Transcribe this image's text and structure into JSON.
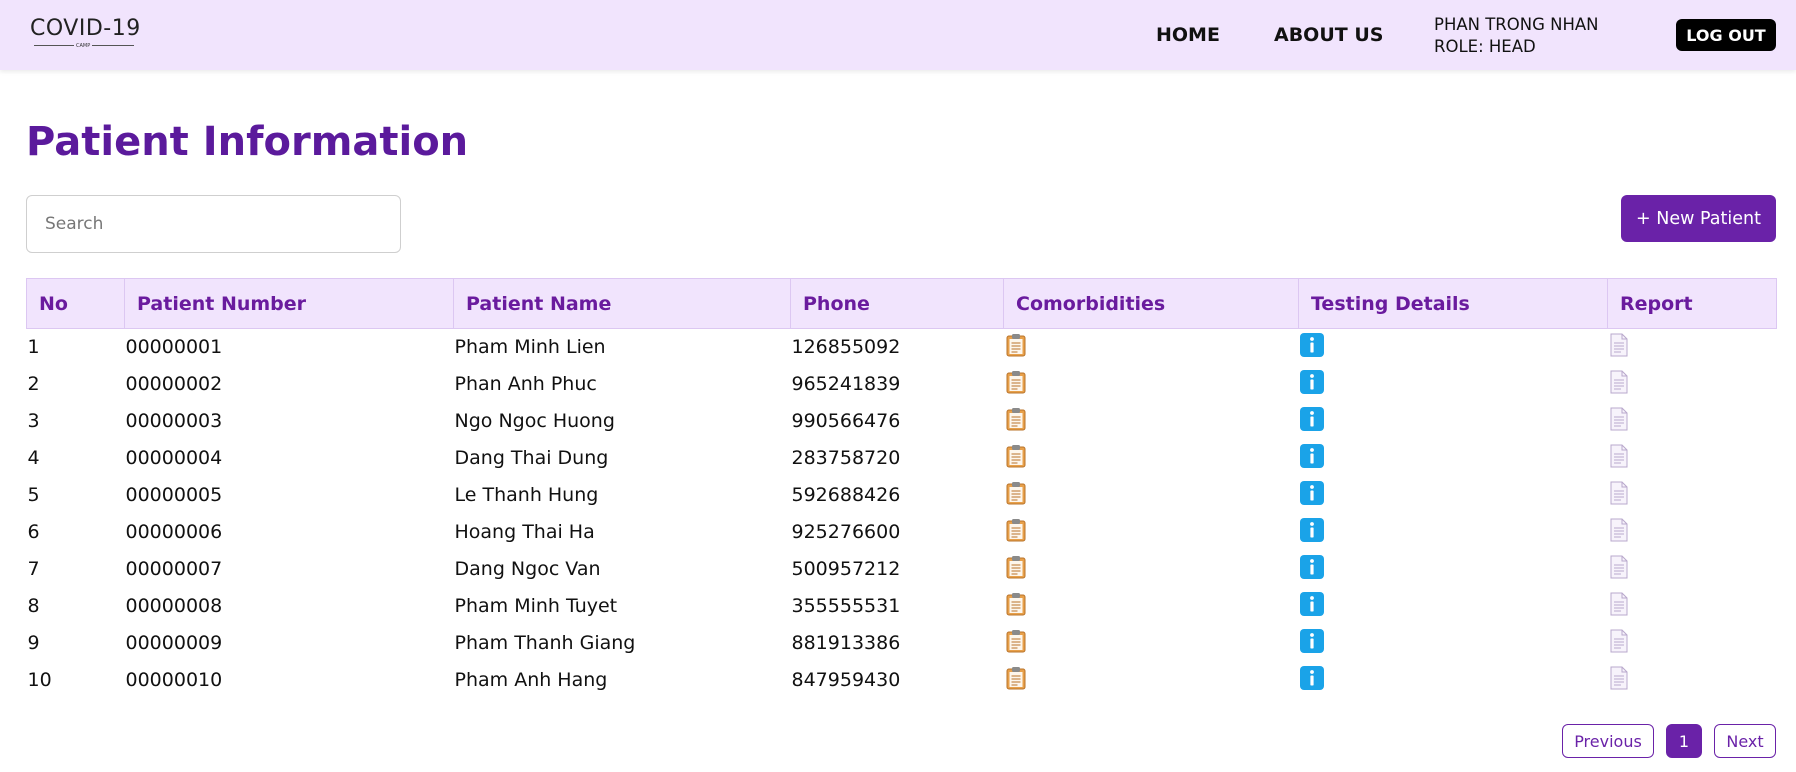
{
  "header": {
    "logo_text": "COVID-19",
    "logo_sub": "CAMP",
    "nav": {
      "home": "HOME",
      "about": "ABOUT US"
    },
    "user": {
      "name": "PHAN TRONG NHAN",
      "role": "ROLE: HEAD"
    },
    "logout_label": "LOG OUT"
  },
  "page": {
    "title": "Patient Information",
    "search_placeholder": "Search",
    "new_patient_label": "+ New Patient"
  },
  "table": {
    "columns": [
      "No",
      "Patient Number",
      "Patient Name",
      "Phone",
      "Comorbidities",
      "Testing Details",
      "Report"
    ],
    "rows": [
      {
        "no": "1",
        "number": "00000001",
        "name": "Pham Minh Lien",
        "phone": "126855092"
      },
      {
        "no": "2",
        "number": "00000002",
        "name": "Phan Anh Phuc",
        "phone": "965241839"
      },
      {
        "no": "3",
        "number": "00000003",
        "name": "Ngo Ngoc Huong",
        "phone": "990566476"
      },
      {
        "no": "4",
        "number": "00000004",
        "name": "Dang Thai Dung",
        "phone": "283758720"
      },
      {
        "no": "5",
        "number": "00000005",
        "name": "Le Thanh Hung",
        "phone": "592688426"
      },
      {
        "no": "6",
        "number": "00000006",
        "name": "Hoang Thai Ha",
        "phone": "925276600"
      },
      {
        "no": "7",
        "number": "00000007",
        "name": "Dang Ngoc Van",
        "phone": "500957212"
      },
      {
        "no": "8",
        "number": "00000008",
        "name": "Pham Minh Tuyet",
        "phone": "355555531"
      },
      {
        "no": "9",
        "number": "00000009",
        "name": "Pham Thanh Giang",
        "phone": "881913386"
      },
      {
        "no": "10",
        "number": "00000010",
        "name": "Pham Anh Hang",
        "phone": "847959430"
      }
    ],
    "icons": {
      "comorbidities": "clipboard-icon",
      "testing": "info-icon",
      "report": "document-icon"
    }
  },
  "pagination": {
    "previous": "Previous",
    "current": "1",
    "next": "Next"
  },
  "colors": {
    "brand": "#6a22a8",
    "title": "#5b1a9c",
    "header_bg": "#f1e4fd",
    "info_blue": "#1aa3e8",
    "clipboard_orange": "#e8a04a"
  }
}
